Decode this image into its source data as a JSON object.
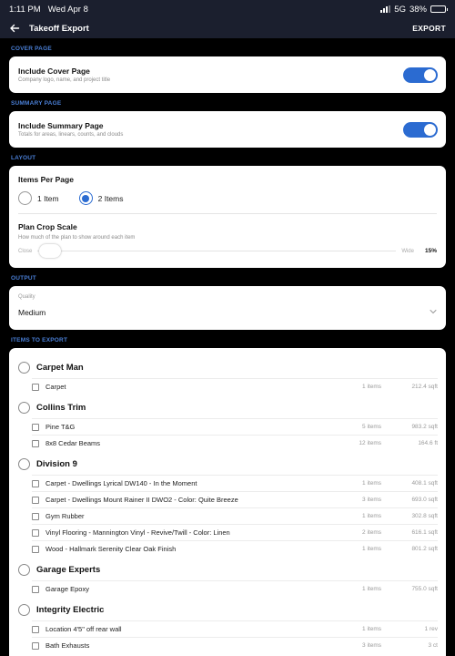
{
  "status": {
    "time": "1:11 PM",
    "date": "Wed Apr 8",
    "network": "5G",
    "battery": "38%",
    "battery_level": 0.38
  },
  "nav": {
    "title": "Takeoff Export",
    "action": "EXPORT"
  },
  "sections": {
    "cover": "COVER PAGE",
    "summary": "SUMMARY PAGE",
    "layout": "LAYOUT",
    "output": "OUTPUT",
    "items": "ITEMS TO EXPORT"
  },
  "cover": {
    "title": "Include Cover Page",
    "subtitle": "Company logo, name, and project title",
    "enabled": true
  },
  "summary": {
    "title": "Include Summary Page",
    "subtitle": "Totals for areas, linears, counts, and clouds",
    "enabled": true
  },
  "layout": {
    "items_per_page_title": "Items Per Page",
    "option_one": "1 Item",
    "option_two": "2 Items",
    "selected": "2 Items",
    "crop_title": "Plan Crop Scale",
    "crop_subtitle": "How much of the plan to show around each item",
    "crop_min_label": "Close",
    "crop_max_label": "Wide",
    "crop_value": "15%"
  },
  "output": {
    "label": "Quality",
    "value": "Medium"
  },
  "groups": [
    {
      "name": "Carpet Man",
      "items": [
        {
          "name": "Carpet",
          "count": "1 items",
          "qty": "212.4 sqft"
        }
      ]
    },
    {
      "name": "Collins Trim",
      "items": [
        {
          "name": "Pine T&G",
          "count": "5 items",
          "qty": "983.2 sqft"
        },
        {
          "name": "8x8 Cedar Beams",
          "count": "12 items",
          "qty": "164.6 ft"
        }
      ]
    },
    {
      "name": "Division 9",
      "items": [
        {
          "name": "Carpet - Dwellings Lyrical DW140 - In the Moment",
          "count": "1 items",
          "qty": "408.1 sqft"
        },
        {
          "name": "Carpet - Dwellings Mount Rainer II DWO2 - Color: Quite Breeze",
          "count": "3 items",
          "qty": "693.0 sqft"
        },
        {
          "name": "Gym Rubber",
          "count": "1 items",
          "qty": "302.8 sqft"
        },
        {
          "name": "Vinyl Flooring - Mannington Vinyl - Revive/Twill - Color: Linen",
          "count": "2 items",
          "qty": "616.1 sqft"
        },
        {
          "name": "Wood - Hallmark Serenity Clear Oak Finish",
          "count": "1 items",
          "qty": "801.2 sqft"
        }
      ]
    },
    {
      "name": "Garage Experts",
      "items": [
        {
          "name": "Garage Epoxy",
          "count": "1 items",
          "qty": "755.0 sqft"
        }
      ]
    },
    {
      "name": "Integrity Electric",
      "items": [
        {
          "name": "Location 4'5\" off rear wall",
          "count": "1 items",
          "qty": "1 rev"
        },
        {
          "name": "Bath Exhausts",
          "count": "3 items",
          "qty": "3 ct"
        }
      ]
    }
  ],
  "colors": {
    "accent": "#2b6bd1",
    "section_label": "#4a7fd6",
    "nav_bg": "#1b1f2e"
  },
  "icons": {
    "back": "arrow-left-icon",
    "chevron": "chevron-down-icon"
  }
}
